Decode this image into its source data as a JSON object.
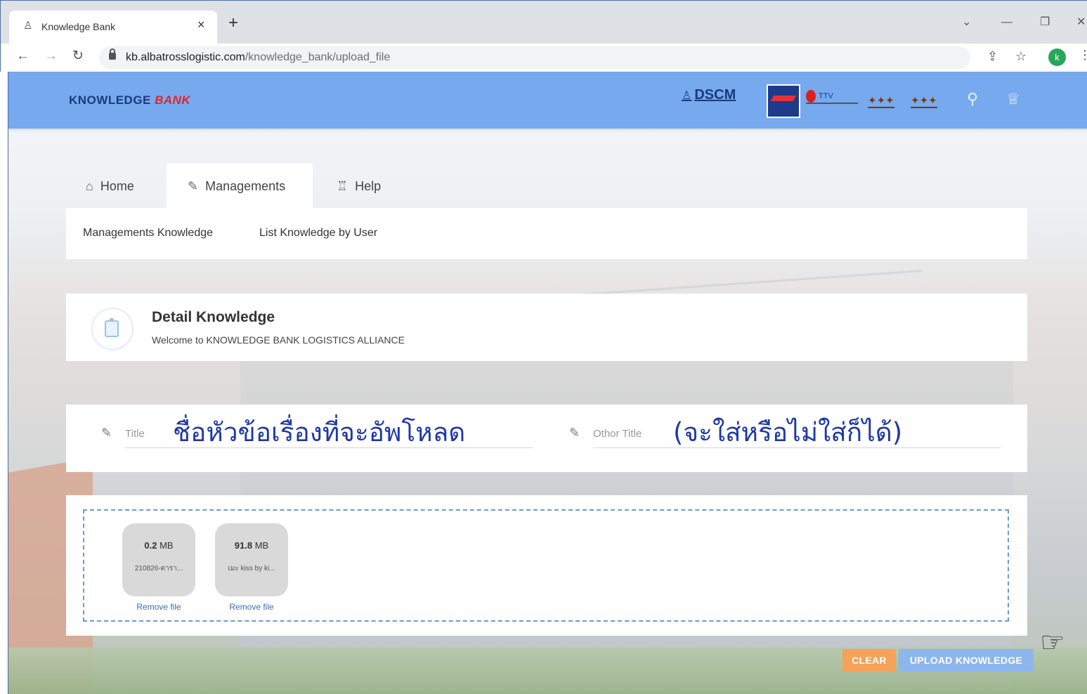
{
  "browser": {
    "tab_title": "Knowledge Bank",
    "tab_close": "×",
    "new_tab": "+",
    "url_host": "kb.albatrosslogistic.com",
    "url_path": "/knowledge_bank/upload_file",
    "profile_initial": "k",
    "icons": [
      "favicon-icon",
      "back-icon",
      "forward-icon",
      "reload-icon",
      "lock-icon",
      "share-icon",
      "star-icon",
      "menu-icon"
    ]
  },
  "header": {
    "brand_part1": "KNOWLEDGE",
    "brand_part2": "BANK",
    "partner_dscm": "DSCM",
    "partner_ttv": "TTV",
    "accent_color": "#77a9ee"
  },
  "nav": {
    "tabs": [
      {
        "label": "Home",
        "icon": "home-icon"
      },
      {
        "label": "Managements",
        "icon": "pencil-icon",
        "active": true
      },
      {
        "label": "Help",
        "icon": "help-icon"
      }
    ],
    "sub_items": [
      "Managements Knowledge",
      "List Knowledge by User"
    ]
  },
  "detail": {
    "title": "Detail Knowledge",
    "subtitle": "Welcome to KNOWLEDGE BANK LOGISTICS ALLIANCE"
  },
  "form": {
    "title_label": "Title",
    "title_annotation": "ชื่อหัวข้อเรื่องที่จะอัพโหลด",
    "other_title_label": "Othor Title",
    "other_title_annotation": "(จะใส่หรือไม่ใส่ก็ได้)"
  },
  "files": [
    {
      "size_value": "0.2",
      "size_unit": "MB",
      "name": "210826-ตารา...",
      "remove_label": "Remove file"
    },
    {
      "size_value": "91.8",
      "size_unit": "MB",
      "name": "เมะ kiss by ki...",
      "remove_label": "Remove file"
    }
  ],
  "actions": {
    "clear_label": "CLEAR",
    "upload_label": "UPLOAD KNOWLEDGE",
    "clear_color": "#f6a25b",
    "upload_color": "#8db6ef"
  }
}
